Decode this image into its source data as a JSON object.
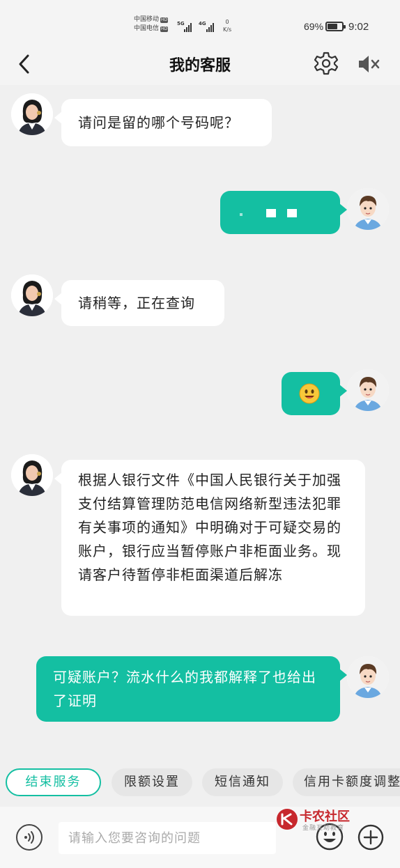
{
  "status_bar": {
    "carrier_1": "中国移动",
    "carrier_2": "中国电信",
    "hd": "HD",
    "net_1": "5G",
    "net_2": "4G",
    "speed_value": "0",
    "speed_unit": "K/s",
    "battery_percent": "69%",
    "battery_level": 0.69,
    "time": "9:02"
  },
  "header": {
    "title": "我的客服",
    "icons": [
      "back-icon",
      "gear-icon",
      "speaker-mute-icon"
    ]
  },
  "messages": [
    {
      "side": "agent",
      "text": "请问是留的哪个号码呢？"
    },
    {
      "side": "user",
      "text": "",
      "content": "redacted-number"
    },
    {
      "side": "agent",
      "text": "请稍等，正在查询"
    },
    {
      "side": "user",
      "text": "",
      "content": "smiley-emoji"
    },
    {
      "side": "agent",
      "text": "根据人银行文件《中国人民银行关于加强支付结算管理防范电信网络新型违法犯罪有关事项的通知》中明确对于可疑交易的账户，银行应当暂停账户非柜面业务。现请客户待暂停非柜面渠道后解冻"
    },
    {
      "side": "user",
      "text": "可疑账户？流水什么的我都解释了也给出了证明"
    }
  ],
  "quick_actions": [
    "结束服务",
    "限额设置",
    "短信通知",
    "信用卡额度调整"
  ],
  "input": {
    "placeholder": "请输入您要咨询的问题",
    "value": ""
  },
  "watermark": {
    "title": "卡农社区",
    "subtitle": "金融互助教育"
  },
  "colors": {
    "accent": "#14bfa2",
    "background": "#f0f0f0",
    "watermark_red": "#c7282d"
  }
}
